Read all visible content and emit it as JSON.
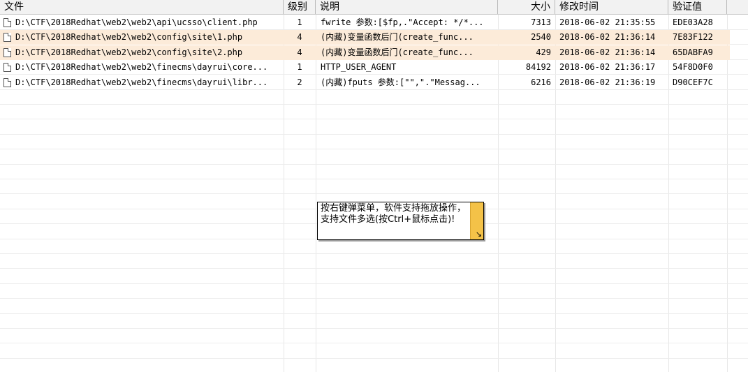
{
  "columns": {
    "file": "文件",
    "level": "级别",
    "desc": "说明",
    "size": "大小",
    "time": "修改时间",
    "hash": "验证值"
  },
  "rows": [
    {
      "file": "D:\\CTF\\2018Redhat\\web2\\web2\\api\\ucsso\\client.php",
      "level": "1",
      "desc": "fwrite 参数:[$fp,.\"Accept: */*...",
      "size": "7313",
      "time": "2018-06-02 21:35:55",
      "hash": "EDE03A28",
      "highlight": false
    },
    {
      "file": "D:\\CTF\\2018Redhat\\web2\\web2\\config\\site\\1.php",
      "level": "4",
      "desc": "(内藏)变量函数后门(create_func...",
      "size": "2540",
      "time": "2018-06-02 21:36:14",
      "hash": "7E83F122",
      "highlight": true
    },
    {
      "file": "D:\\CTF\\2018Redhat\\web2\\web2\\config\\site\\2.php",
      "level": "4",
      "desc": "(内藏)变量函数后门(create_func...",
      "size": "429",
      "time": "2018-06-02 21:36:14",
      "hash": "65DABFA9",
      "highlight": true
    },
    {
      "file": "D:\\CTF\\2018Redhat\\web2\\web2\\finecms\\dayrui\\core...",
      "level": "1",
      "desc": "HTTP_USER_AGENT",
      "size": "84192",
      "time": "2018-06-02 21:36:17",
      "hash": "54F8D0F0",
      "highlight": false
    },
    {
      "file": "D:\\CTF\\2018Redhat\\web2\\web2\\finecms\\dayrui\\libr...",
      "level": "2",
      "desc": "(内藏)fputs 参数:[\"\",\".\"Messag...",
      "size": "6216",
      "time": "2018-06-02 21:36:19",
      "hash": "D90CEF7C",
      "highlight": false
    }
  ],
  "tooltip": {
    "text": "按右键弹菜单，软件支持拖放操作，支持文件多选(按Ctrl+鼠标点击)!",
    "corner_glyph": "↘"
  },
  "colors": {
    "highlight_row": "#fcebd9",
    "tooltip_bar": "#f4c248"
  },
  "icons": {
    "row_icon": "document-icon"
  }
}
